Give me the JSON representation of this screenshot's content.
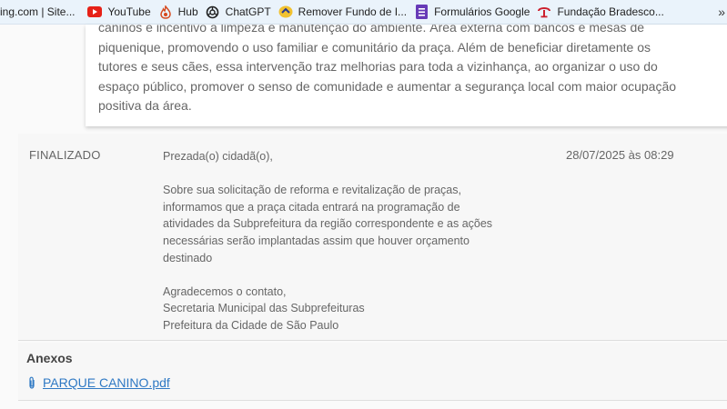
{
  "bookmarks": [
    {
      "label": "ing.com | Site...",
      "icon": "none"
    },
    {
      "label": "YouTube",
      "icon": "youtube-icon"
    },
    {
      "label": "Hub",
      "icon": "flame-icon"
    },
    {
      "label": "ChatGPT",
      "icon": "chatgpt-icon"
    },
    {
      "label": "Remover Fundo de I...",
      "icon": "remove-bg-icon"
    },
    {
      "label": "Formulários Google",
      "icon": "google-forms-icon"
    },
    {
      "label": "Fundação Bradesco...",
      "icon": "bradesco-icon"
    }
  ],
  "description": {
    "lines": [
      "caninos e incentivo à limpeza e manutenção do ambiente. Área externa com bancos e mesas de",
      "piquenique, promovendo o uso familiar e comunitário da praça. Além de beneficiar diretamente os",
      "tutores e seus cães, essa intervenção traz melhorias para toda a vizinhança, ao organizar o uso do",
      "espaço público, promover o senso de comunidade e aumentar a segurança local com maior ocupação",
      "positiva da área."
    ]
  },
  "response": {
    "status": "FINALIZADO",
    "date": "28/07/2025 às 08:29",
    "greeting": "Prezada(o) cidadã(o),",
    "body_lines": [
      "Sobre sua solicitação de reforma e revitalização de praças,",
      "informamos que a praça citada entrará na programação de",
      "atividades da Subprefeitura da região correspondente e as ações",
      "necessárias serão implantadas assim que houver orçamento",
      "destinado"
    ],
    "closing_lines": [
      "Agradecemos o contato,",
      "Secretaria Municipal das Subprefeituras",
      "Prefeitura da Cidade de São Paulo"
    ]
  },
  "attachments": {
    "title": "Anexos",
    "files": [
      {
        "name": "PARQUE CANINO.pdf"
      }
    ]
  },
  "colors": {
    "bookmarks_bg": "#eaf3fb",
    "link": "#2f79c4",
    "youtube_red": "#e62117",
    "forms_purple": "#673ab7"
  }
}
